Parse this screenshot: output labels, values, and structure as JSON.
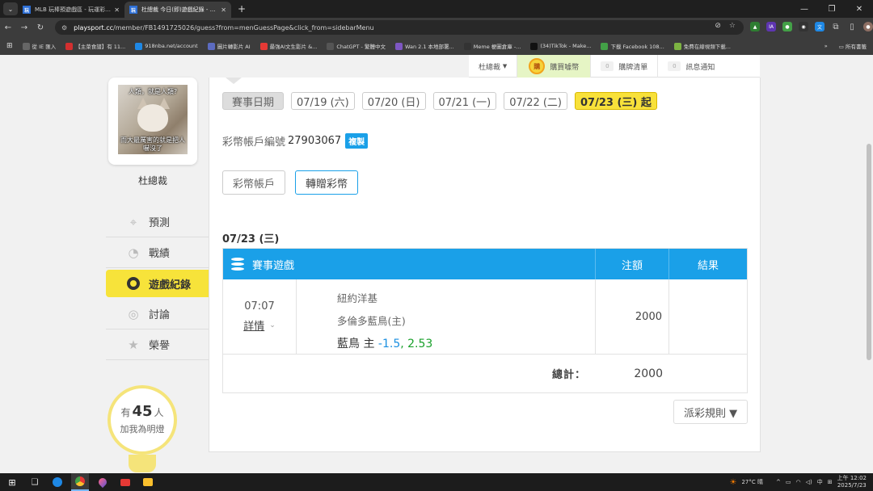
{
  "browser": {
    "tabs": [
      {
        "title": "MLB 玩棒預遊戲區 - 玩運彩 台...",
        "favicon": "玩",
        "active": false
      },
      {
        "title": "杜總裁 今日(即)遊戲紀錄 - 玩運...",
        "favicon": "玩",
        "active": true
      }
    ],
    "new_tab": "+",
    "url_host": "playsport.cc",
    "url_path": "/member/FB1491725026/guess?from=menGuessPage&click_from=sidebarMenu",
    "bookmarks": [
      {
        "label": "從 IE 匯入",
        "color": "#666666"
      },
      {
        "label": "【主菜食譜】有 11...",
        "color": "#d32f2f"
      },
      {
        "label": "918nba.net/account",
        "color": "#1e88e5"
      },
      {
        "label": "圖片轉影片 AI",
        "color": "#5c6bc0"
      },
      {
        "label": "最強AI文生影片 &...",
        "color": "#e53935"
      },
      {
        "label": "ChatGPT - 繁體中文",
        "color": "#555555"
      },
      {
        "label": "Wan 2.1 本地部署...",
        "color": "#7e57c2"
      },
      {
        "label": "Meme 梗圖倉庫 -...",
        "color": "#333333"
      },
      {
        "label": "(34)TikTok - Make...",
        "color": "#111111"
      },
      {
        "label": "下載 Facebook 108...",
        "color": "#43a047"
      },
      {
        "label": "免費在線視頻下載...",
        "color": "#7cb342"
      }
    ],
    "bookmarks_more": "»",
    "bookmarks_all": "所有書籤"
  },
  "topnav": {
    "user": "杜總裁",
    "user_caret": "▼",
    "buy_icon": "購",
    "buy_label": "購買噱幣",
    "cart_count": "0",
    "cart_label": "購牌清單",
    "notify_count": "0",
    "notify_label": "訊息通知"
  },
  "profile": {
    "meme_top": "人類，就是人類?",
    "meme_bottom": "而大最厲害的就是把人嚇沒了",
    "name": "杜總裁"
  },
  "sidebar": {
    "items": [
      {
        "label": "預測",
        "icon": "crosshair-icon",
        "glyph": "⌖",
        "active": false
      },
      {
        "label": "戰績",
        "icon": "chart-icon",
        "glyph": "◔",
        "active": false
      },
      {
        "label": "遊戲紀錄",
        "icon": "ring-icon",
        "glyph": "",
        "active": true
      },
      {
        "label": "討論",
        "icon": "chat-icon",
        "glyph": "◎",
        "active": false
      },
      {
        "label": "榮譽",
        "icon": "medal-icon",
        "glyph": "★",
        "active": false
      }
    ]
  },
  "bulb": {
    "prefix": "有",
    "count": "45",
    "suffix": "人",
    "line2": "加我為明燈"
  },
  "dates": {
    "label": "賽事日期",
    "items": [
      {
        "text": "07/19 (六)",
        "selected": false
      },
      {
        "text": "07/20 (日)",
        "selected": false
      },
      {
        "text": "07/21 (一)",
        "selected": false
      },
      {
        "text": "07/22 (二)",
        "selected": false
      },
      {
        "text": "07/23 (三) 起",
        "selected": true
      }
    ]
  },
  "account": {
    "label": "彩幣帳戶編號",
    "number": "27903067",
    "copy": "複製"
  },
  "buttons": {
    "coin_account": "彩幣帳戶",
    "transfer": "轉贈彩幣"
  },
  "day_title": "07/23 (三)",
  "table": {
    "headers": {
      "game": "賽事遊戲",
      "bet": "注額",
      "result": "結果"
    },
    "rows": [
      {
        "time": "07:07",
        "detail": "詳情",
        "away": "紐約洋基",
        "home": "多倫多藍鳥(主)",
        "pick_team": "藍鳥 主",
        "pick_line": "-1.5",
        "pick_odds": "2.53",
        "amount": "2000",
        "result": ""
      }
    ],
    "total_label": "總計：",
    "total_value": "2000"
  },
  "rules_button": "派彩規則 ▼",
  "taskbar": {
    "weather": "27°C 晴",
    "ime": "中",
    "time": "上午 12:02",
    "date": "2025/7/23"
  }
}
